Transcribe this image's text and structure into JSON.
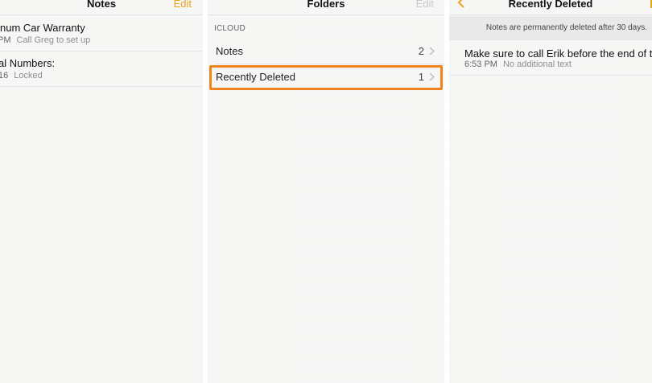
{
  "notes_panel": {
    "title": "Notes",
    "edit_label": "Edit",
    "items": [
      {
        "title": "num Car Warranty",
        "time": "PM",
        "preview": "Call Greg to set up"
      },
      {
        "title": "al Numbers:",
        "time": "16",
        "preview": "Locked"
      }
    ]
  },
  "folders_panel": {
    "title": "Folders",
    "edit_label": "Edit",
    "section": "ICLOUD",
    "folders": [
      {
        "label": "Notes",
        "count": "2"
      },
      {
        "label": "Recently Deleted",
        "count": "1"
      }
    ]
  },
  "deleted_panel": {
    "title": "Recently Deleted",
    "banner": "Notes are permanently deleted after 30 days.",
    "items": [
      {
        "title": "Make sure to call Erik before the end of the",
        "time": "6:53 PM",
        "preview": "No additional text"
      }
    ]
  },
  "colors": {
    "accent": "#e7a421",
    "highlight": "#f0851f",
    "panel_bg": "#f7f7f6",
    "gutter": "#ffffff"
  }
}
